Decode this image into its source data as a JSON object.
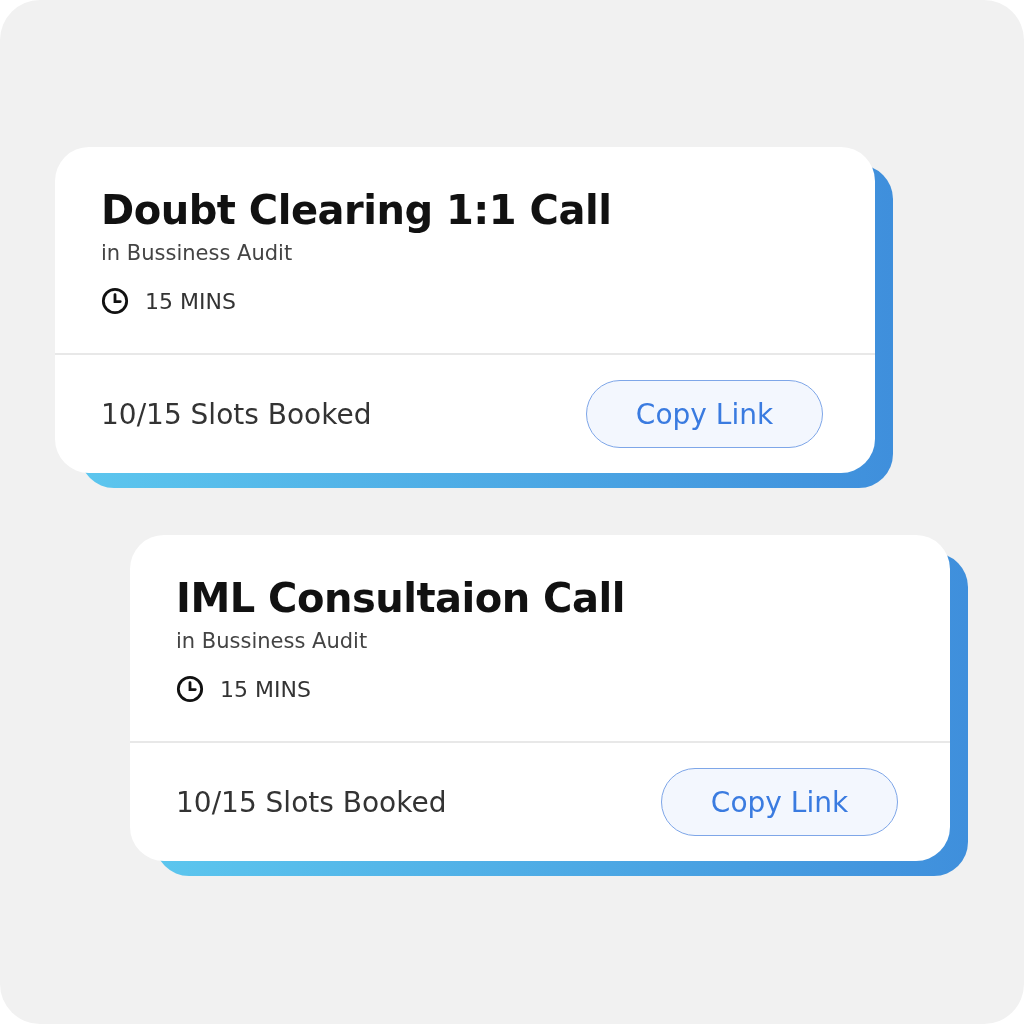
{
  "cards": [
    {
      "title": "Doubt Clearing 1:1 Call",
      "subtitle": "in Bussiness Audit",
      "duration": "15 MINS",
      "slots": "10/15 Slots Booked",
      "button": "Copy Link"
    },
    {
      "title": "IML Consultaion Call",
      "subtitle": "in Bussiness Audit",
      "duration": "15 MINS",
      "slots": "10/15 Slots Booked",
      "button": "Copy Link"
    }
  ]
}
